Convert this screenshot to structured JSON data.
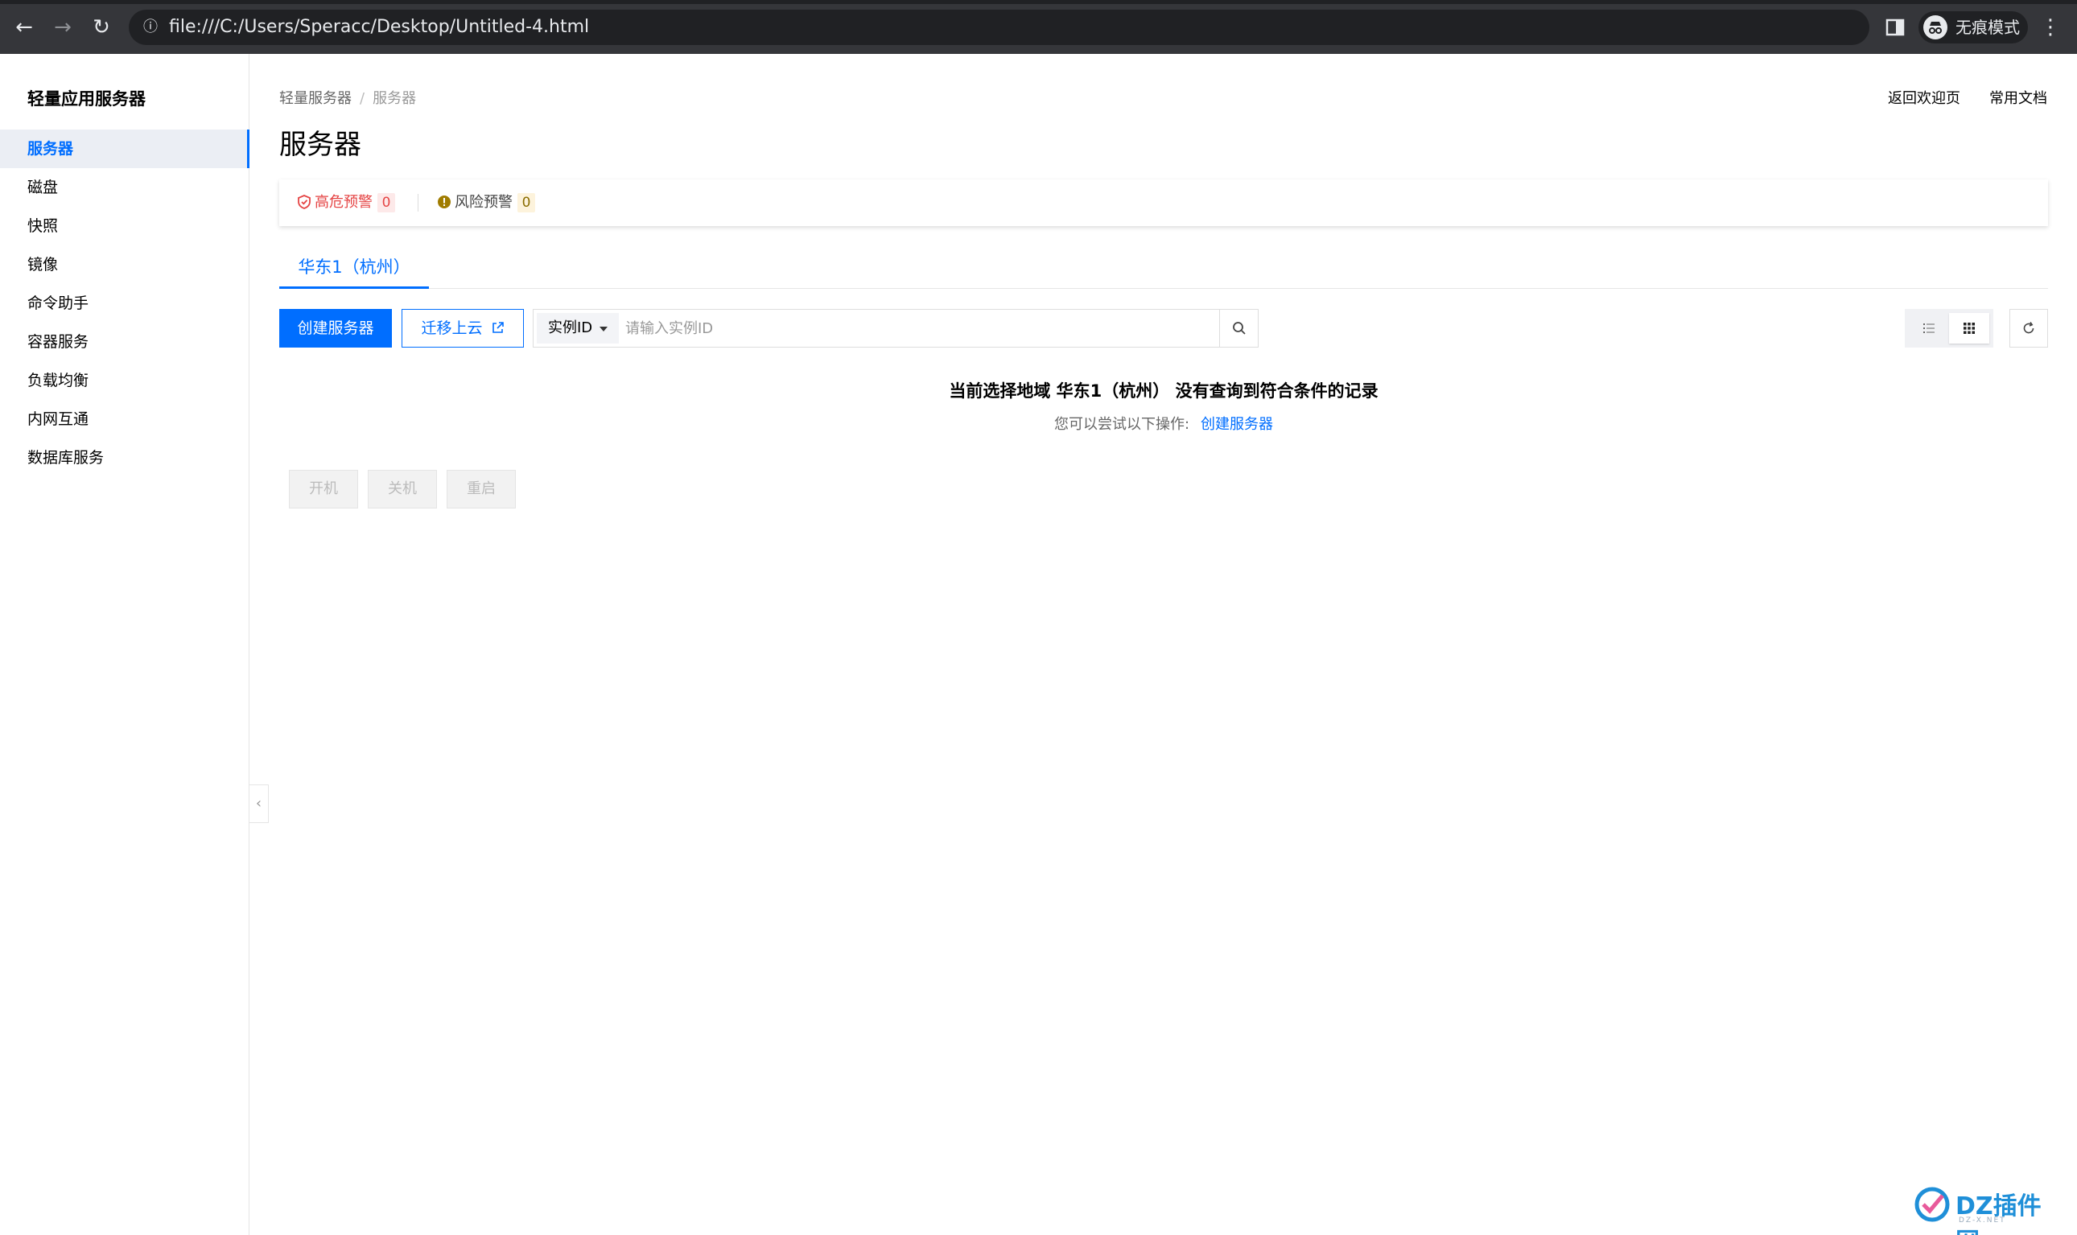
{
  "browser": {
    "url": "file:///C:/Users/Speracc/Desktop/Untitled-4.html",
    "incognito_label": "无痕模式"
  },
  "sidebar": {
    "title": "轻量应用服务器",
    "items": [
      {
        "label": "服务器",
        "active": true
      },
      {
        "label": "磁盘",
        "active": false
      },
      {
        "label": "快照",
        "active": false
      },
      {
        "label": "镜像",
        "active": false
      },
      {
        "label": "命令助手",
        "active": false
      },
      {
        "label": "容器服务",
        "active": false
      },
      {
        "label": "负载均衡",
        "active": false
      },
      {
        "label": "内网互通",
        "active": false
      },
      {
        "label": "数据库服务",
        "active": false
      }
    ]
  },
  "breadcrumb": {
    "parent": "轻量服务器",
    "separator": "/",
    "current": "服务器"
  },
  "header": {
    "title": "服务器",
    "links": {
      "welcome": "返回欢迎页",
      "docs": "常用文档"
    }
  },
  "alerts": {
    "high_label": "高危预警",
    "high_count": "0",
    "risk_label": "风险预警",
    "risk_count": "0"
  },
  "tabs": [
    {
      "label": "华东1（杭州）",
      "active": true
    }
  ],
  "toolbar": {
    "create_label": "创建服务器",
    "migrate_label": "迁移上云",
    "search_field": "实例ID",
    "search_placeholder": "请输入实例ID"
  },
  "empty": {
    "title": "当前选择地域 华东1（杭州） 没有查询到符合条件的记录",
    "hint": "您可以尝试以下操作:",
    "action": "创建服务器"
  },
  "batch_actions": {
    "start": "开机",
    "stop": "关机",
    "restart": "重启"
  },
  "watermark": {
    "text": "DZ插件网",
    "sub": "DZ-X.NET"
  },
  "colors": {
    "accent": "#006eff",
    "danger": "#e54545",
    "warning": "#8a6d00"
  }
}
